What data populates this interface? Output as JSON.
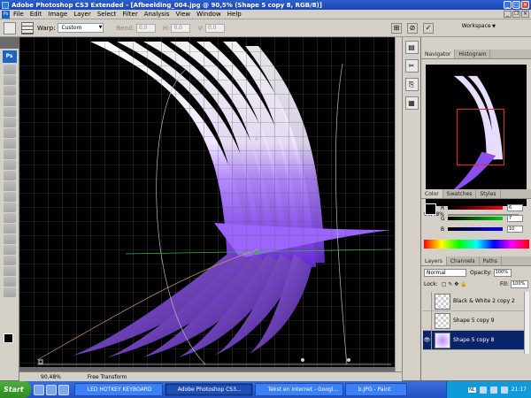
{
  "window": {
    "title": "Adobe Photoshop CS3 Extended - [Afbeelding_004.jpg @ 90,5% (Shape 5 copy 8, RGB/8)]"
  },
  "menu": {
    "items": [
      "File",
      "Edit",
      "Image",
      "Layer",
      "Select",
      "Filter",
      "Analysis",
      "View",
      "Window",
      "Help"
    ]
  },
  "options": {
    "warp_label": "Warp:",
    "warp_value": "Custom",
    "bend_label": "Bend:",
    "bend_value": "0,0",
    "h_label": "H:",
    "h_value": "0,0",
    "v_label": "V:",
    "v_value": "0,0",
    "workspace_label": "Workspace"
  },
  "toolbox": {
    "logo": "Ps"
  },
  "status": {
    "zoom": "90,48%",
    "mode": "Free Transform"
  },
  "navigator": {
    "tabs": [
      "Navigator",
      "Histogram"
    ],
    "zoom": "90,48%"
  },
  "color": {
    "tabs": [
      "Color",
      "Swatches",
      "Styles"
    ],
    "channels": [
      {
        "label": "R",
        "value": "6"
      },
      {
        "label": "G",
        "value": "7"
      },
      {
        "label": "B",
        "value": "10"
      }
    ]
  },
  "layers": {
    "tabs": [
      "Layers",
      "Channels",
      "Paths"
    ],
    "blend_mode": "Normal",
    "opacity_label": "Opacity:",
    "opacity_value": "100%",
    "lock_label": "Lock:",
    "fill_label": "Fill:",
    "fill_value": "100%",
    "items": [
      {
        "name": "Black & White 2 copy 2",
        "selected": false
      },
      {
        "name": "Shape 5 copy 9",
        "selected": false
      },
      {
        "name": "Shape 5 copy 8",
        "selected": true
      }
    ]
  },
  "taskbar": {
    "start_label": "Start",
    "buttons": [
      "LED HOTKEY KEYBOARD",
      "Adobe Photoshop CS3...",
      "Tekst en internet - Googl...",
      "b.JPG - Paint"
    ],
    "time": "21:17",
    "lang": "NL"
  },
  "colors": {
    "titlebar": "#1c47b3",
    "selected_layer": "#0a246a",
    "artwork_purple": "#8a4ff0",
    "nav_frame": "#e52a2a"
  }
}
